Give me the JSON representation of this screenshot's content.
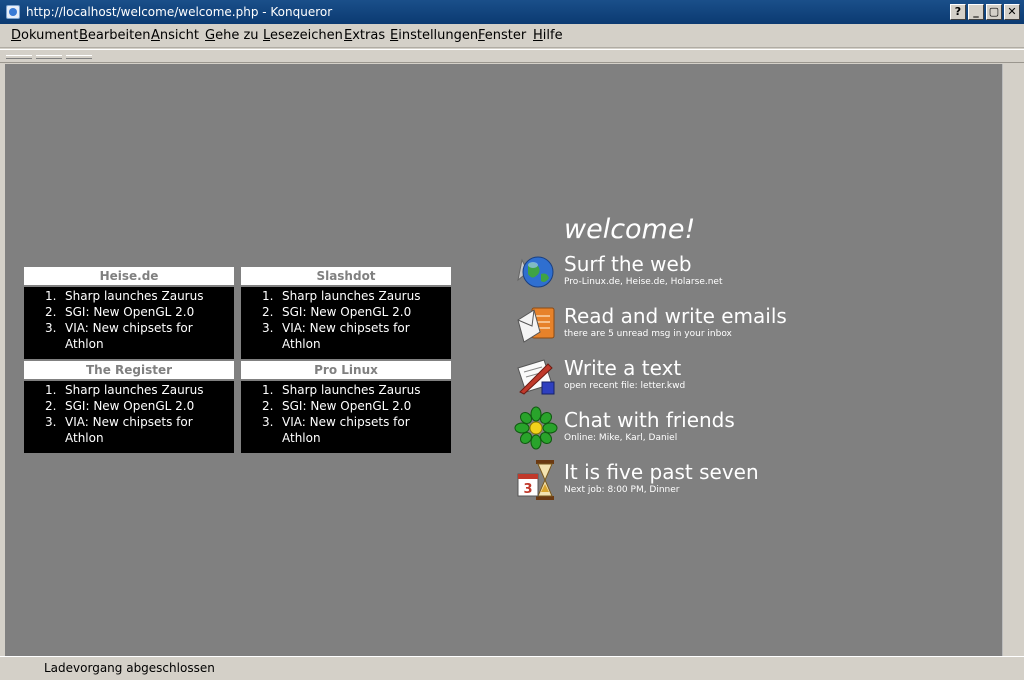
{
  "window": {
    "title": "http://localhost/welcome/welcome.php - Konqueror",
    "buttons": [
      "?",
      "_",
      "▢",
      "✕"
    ]
  },
  "menu": [
    "Dokument",
    "Bearbeiten",
    "Ansicht",
    "Gehe zu",
    "Lesezeichen",
    "Extras",
    "Einstellungen",
    "Fenster",
    "Hilfe"
  ],
  "news": [
    {
      "title": "Heise.de",
      "items": [
        "Sharp launches Zaurus",
        "SGI: New OpenGL 2.0",
        "VIA: New chipsets for Athlon"
      ]
    },
    {
      "title": "Slashdot",
      "items": [
        "Sharp launches Zaurus",
        "SGI: New OpenGL 2.0",
        "VIA: New chipsets for Athlon"
      ]
    },
    {
      "title": "The Register",
      "items": [
        "Sharp launches Zaurus",
        "SGI: New OpenGL 2.0",
        "VIA: New chipsets for Athlon"
      ]
    },
    {
      "title": "Pro Linux",
      "items": [
        "Sharp launches Zaurus",
        "SGI: New OpenGL 2.0",
        "VIA: New chipsets for Athlon"
      ]
    }
  ],
  "welcome": "welcome!",
  "entries": [
    {
      "label": "Surf the web",
      "sub": "Pro-Linux.de, Heise.de, Holarse.net",
      "icon": "globe-icon"
    },
    {
      "label": "Read and write emails",
      "sub": "there are 5 unread msg in your inbox",
      "icon": "mail-icon"
    },
    {
      "label": "Write a text",
      "sub": "open recent file: letter.kwd",
      "icon": "writer-icon"
    },
    {
      "label": "Chat with friends",
      "sub": "Online: Mike, Karl, Daniel",
      "icon": "flower-icon"
    },
    {
      "label": "It is five past seven",
      "sub": "Next job: 8:00 PM, Dinner",
      "icon": "calendar-clock-icon"
    }
  ],
  "calendar_day": "3",
  "status": "Ladevorgang abgeschlossen"
}
